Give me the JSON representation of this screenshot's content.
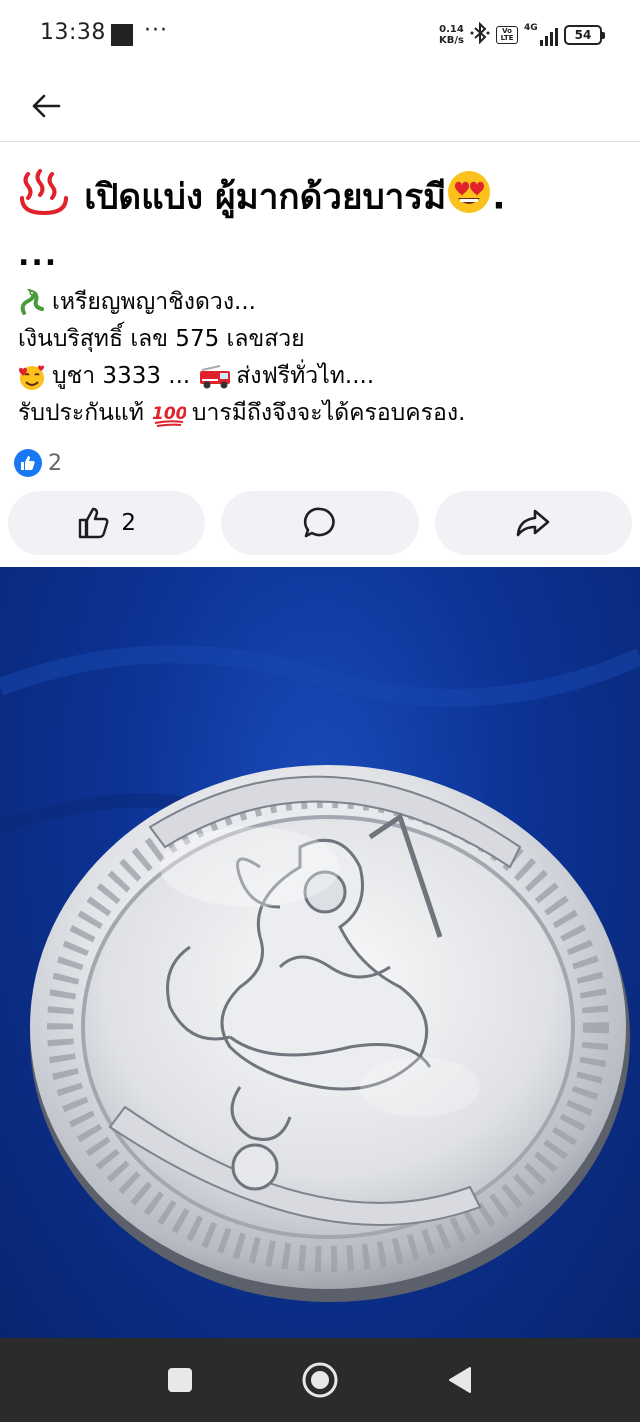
{
  "status_bar": {
    "time": "13:38",
    "more": "···",
    "net_speed_value": "0.14",
    "net_speed_unit": "KB/s",
    "volte_top": "Vo",
    "volte_bottom": "LTE",
    "signal_label": "4G",
    "battery": "54"
  },
  "header": {
    "back_icon": "arrow-left-icon"
  },
  "post": {
    "title": "เปิดแบ่ง ผู้มากด้วยบารมี",
    "title_trailing": ".",
    "ellipsis": "...",
    "lines": [
      "เหรียญพญาชิงดวง...",
      "เงินบริสุทธิ์   เลข 575  เลขสวย",
      "บูชา 3333  ...",
      "ส่งฟรีทั่วไท....",
      "รับประกันแท้",
      "บารมีถึงจึงจะได้ครอบครอง."
    ],
    "reaction_count": "2",
    "actions": {
      "like_count": "2"
    }
  },
  "photo": {
    "subject": "silver medallion on blue cloth"
  },
  "colors": {
    "accent": "#1877f2",
    "action_bg": "#f0f2f5",
    "nav_bg": "#2b2b2b",
    "cloth_blue": "#0c3294"
  }
}
